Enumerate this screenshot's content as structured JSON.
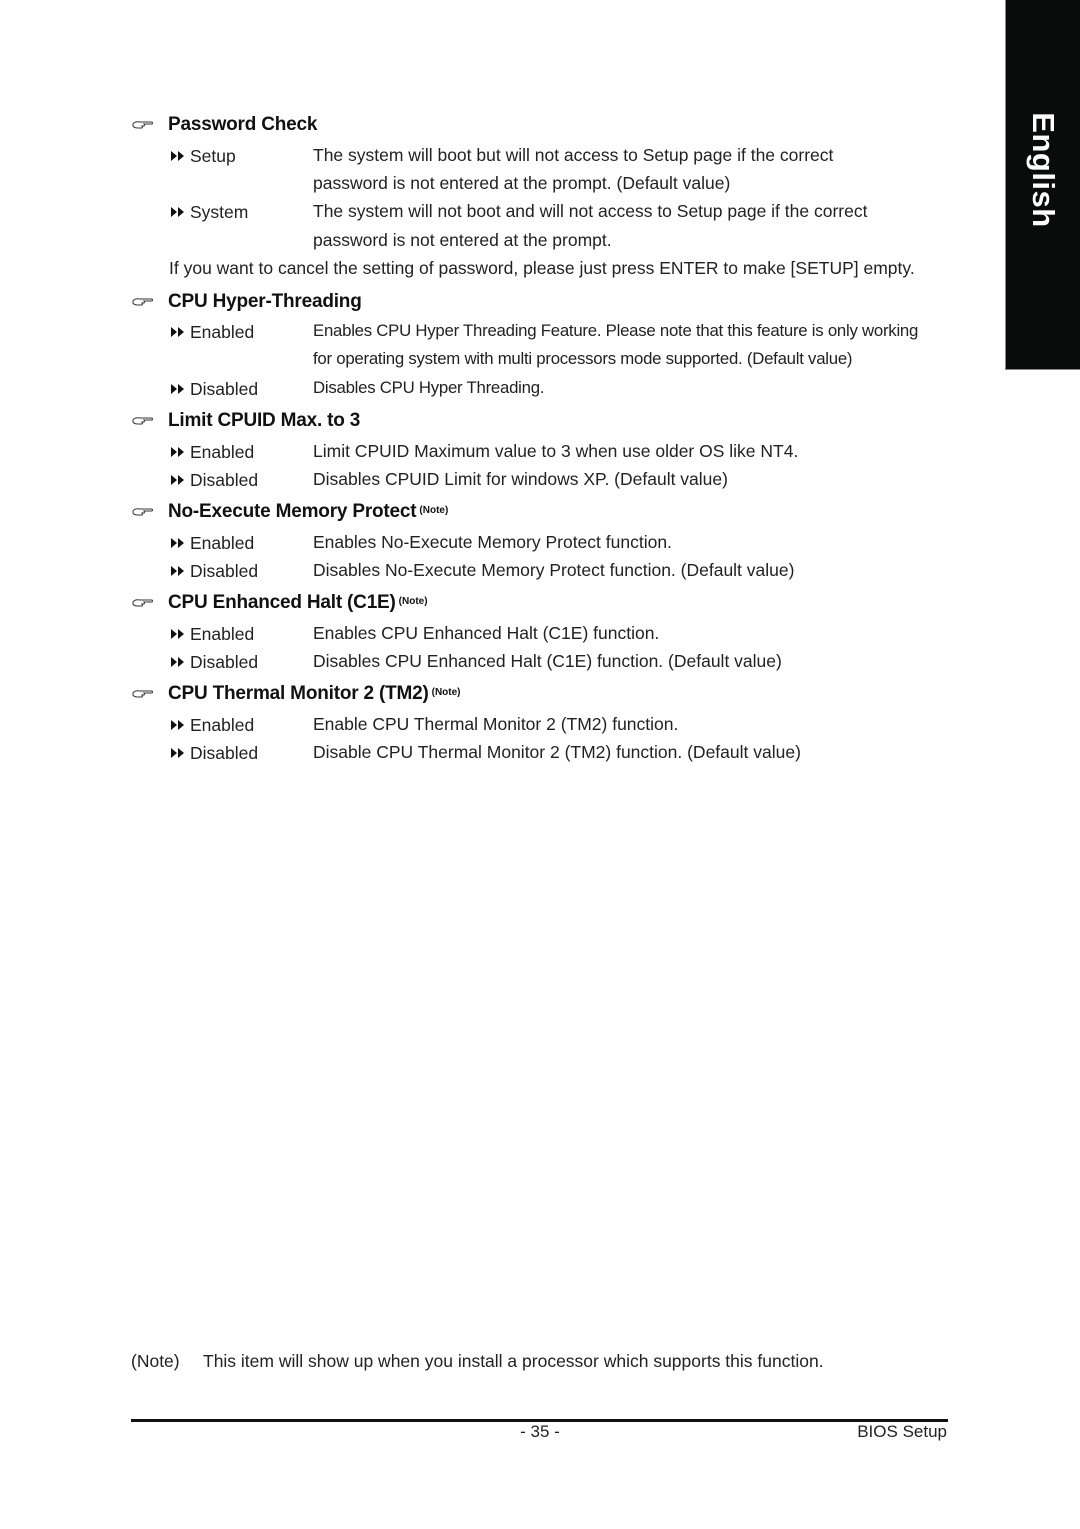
{
  "side_tab": {
    "label": "English"
  },
  "sections": [
    {
      "title": "Password Check",
      "note": "",
      "options": [
        {
          "label": "Setup",
          "lines": [
            "The system will boot but will not access to Setup page if the correct",
            "password is not entered at the prompt. (Default value)"
          ]
        },
        {
          "label": "System",
          "lines": [
            "The system will not boot and will not access to Setup page if the correct",
            "password is not entered at the prompt."
          ]
        }
      ],
      "footer_text": "If you want to cancel the setting of password, please just press ENTER to make [SETUP] empty."
    },
    {
      "title": "CPU Hyper-Threading",
      "note": "",
      "options": [
        {
          "label": "Enabled",
          "lines": [
            "Enables CPU Hyper Threading Feature. Please note that this feature is only working",
            "for operating system with multi processors mode supported. (Default value)"
          ]
        },
        {
          "label": "Disabled",
          "lines": [
            "Disables CPU Hyper Threading."
          ]
        }
      ]
    },
    {
      "title": "Limit CPUID Max. to 3",
      "note": "",
      "options": [
        {
          "label": "Enabled",
          "lines": [
            "Limit CPUID Maximum value to 3 when use older OS like NT4."
          ]
        },
        {
          "label": "Disabled",
          "lines": [
            "Disables CPUID Limit for windows XP. (Default value)"
          ]
        }
      ]
    },
    {
      "title": "No-Execute Memory Protect",
      "note": "(Note)",
      "options": [
        {
          "label": "Enabled",
          "lines": [
            "Enables No-Execute Memory Protect function."
          ]
        },
        {
          "label": "Disabled",
          "lines": [
            "Disables No-Execute Memory Protect function. (Default value)"
          ]
        }
      ]
    },
    {
      "title": "CPU Enhanced Halt (C1E)",
      "note": "(Note)",
      "options": [
        {
          "label": "Enabled",
          "lines": [
            "Enables CPU Enhanced Halt (C1E) function."
          ]
        },
        {
          "label": "Disabled",
          "lines": [
            "Disables CPU Enhanced Halt (C1E) function. (Default value)"
          ]
        }
      ]
    },
    {
      "title": "CPU Thermal Monitor 2 (TM2)",
      "note": "(Note)",
      "options": [
        {
          "label": "Enabled",
          "lines": [
            "Enable CPU Thermal Monitor 2 (TM2) function."
          ]
        },
        {
          "label": "Disabled",
          "lines": [
            "Disable CPU Thermal Monitor 2 (TM2) function. (Default value)"
          ]
        }
      ]
    }
  ],
  "footnote": {
    "label": "(Note)",
    "text": "This item will show up when you install a processor which supports this function."
  },
  "footer": {
    "page_number": "- 35 -",
    "title": "BIOS Setup"
  }
}
